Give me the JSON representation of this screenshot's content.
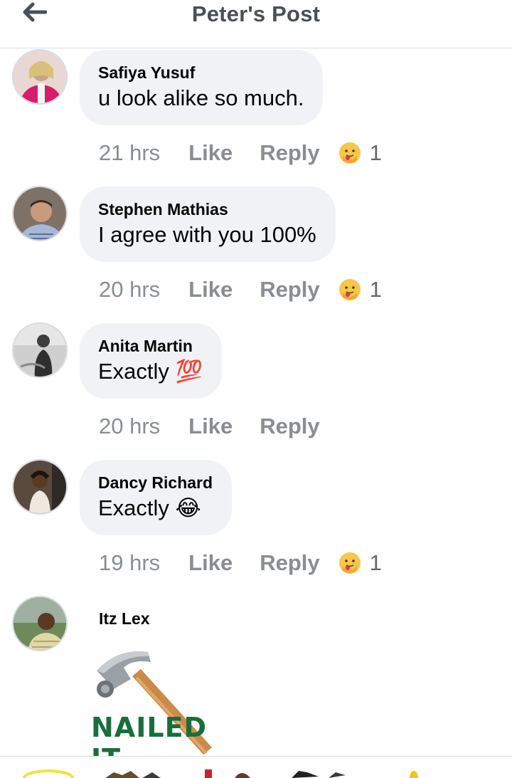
{
  "header": {
    "title": "Peter's Post",
    "back_icon": "arrow-left-icon"
  },
  "comments": [
    {
      "author": "Safiya Yusuf",
      "text": "u look alike so much.",
      "time": "21 hrs",
      "like": "Like",
      "reply": "Reply",
      "reaction_count": "1",
      "reaction_icon": "care-reaction-icon"
    },
    {
      "author": "Stephen Mathias",
      "text": "I agree with you 100%",
      "time": "20 hrs",
      "like": "Like",
      "reply": "Reply",
      "reaction_count": "1",
      "reaction_icon": "care-reaction-icon"
    },
    {
      "author": "Anita Martin",
      "text": "Exactly",
      "emoji": "💯",
      "time": "20 hrs",
      "like": "Like",
      "reply": "Reply"
    },
    {
      "author": "Dancy Richard",
      "text": "Exactly",
      "emoji": "😂",
      "time": "19 hrs",
      "like": "Like",
      "reply": "Reply",
      "reaction_count": "1",
      "reaction_icon": "care-reaction-icon"
    },
    {
      "author": "Itz Lex",
      "sticker_text": "NAILED IT",
      "sticker_icon": "hammer-sticker"
    }
  ],
  "colors": {
    "bubble": "#f0f2f5",
    "meta_text": "#8a8d91",
    "sticker_green": "#1a6e3c"
  }
}
